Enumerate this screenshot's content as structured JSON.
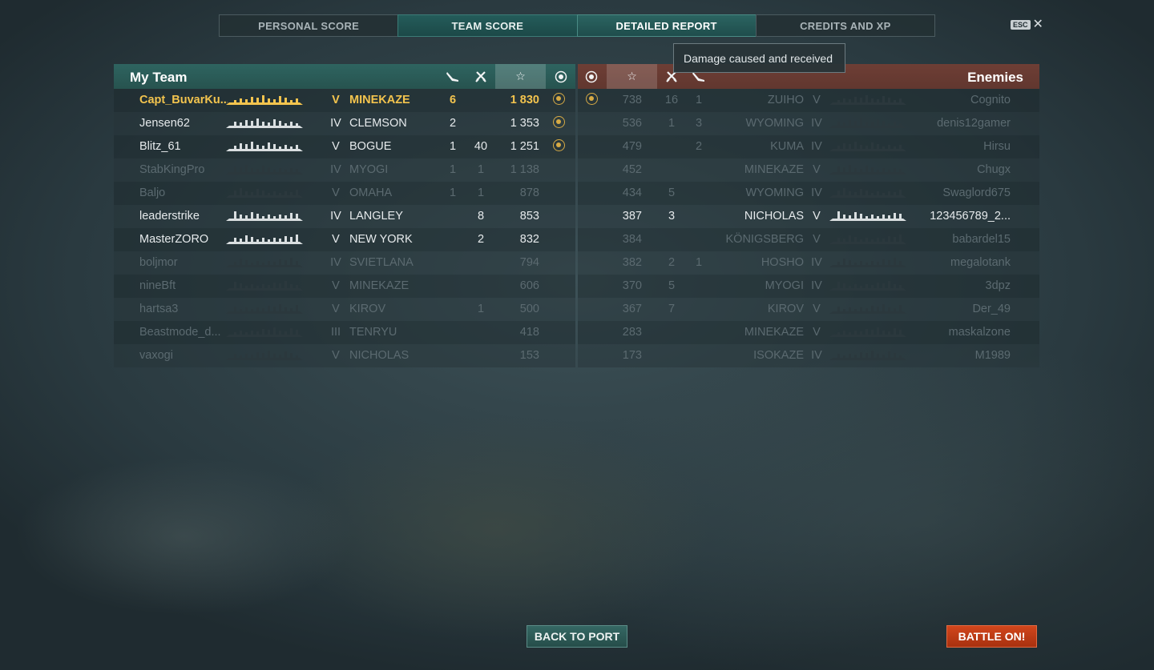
{
  "tabs": [
    {
      "label": "PERSONAL SCORE",
      "active": false
    },
    {
      "label": "TEAM SCORE",
      "active": true
    },
    {
      "label": "DETAILED REPORT",
      "active": true
    },
    {
      "label": "CREDITS AND XP",
      "active": false
    }
  ],
  "esc_label": "ESC",
  "close_glyph": "✕",
  "tooltip": "Damage caused and received",
  "my_team": {
    "title": "My Team",
    "header_icons": [
      "torpedo-icon",
      "planes-icon",
      "star-icon",
      "medal-icon"
    ],
    "rows": [
      {
        "player": "Capt_BuvarKu...",
        "tier": "V",
        "ship": "MINEKAZE",
        "c1": "6",
        "c2": "",
        "score": "1 830",
        "medal": true,
        "state": "self"
      },
      {
        "player": "Jensen62",
        "tier": "IV",
        "ship": "CLEMSON",
        "c1": "2",
        "c2": "",
        "score": "1 353",
        "medal": true,
        "state": "alive"
      },
      {
        "player": "Blitz_61",
        "tier": "V",
        "ship": "BOGUE",
        "c1": "1",
        "c2": "40",
        "score": "1 251",
        "medal": true,
        "state": "alive"
      },
      {
        "player": "StabKingPro",
        "tier": "IV",
        "ship": "MYOGI",
        "c1": "1",
        "c2": "1",
        "score": "1 138",
        "medal": false,
        "state": "dead"
      },
      {
        "player": "Baljo",
        "tier": "V",
        "ship": "OMAHA",
        "c1": "1",
        "c2": "1",
        "score": "878",
        "medal": false,
        "state": "dead"
      },
      {
        "player": "leaderstrike",
        "tier": "IV",
        "ship": "LANGLEY",
        "c1": "",
        "c2": "8",
        "score": "853",
        "medal": false,
        "state": "alive"
      },
      {
        "player": "MasterZORO",
        "tier": "V",
        "ship": "NEW YORK",
        "c1": "",
        "c2": "2",
        "score": "832",
        "medal": false,
        "state": "alive"
      },
      {
        "player": "boljmor",
        "tier": "IV",
        "ship": "SVIETLANA",
        "c1": "",
        "c2": "",
        "score": "794",
        "medal": false,
        "state": "dead"
      },
      {
        "player": "nineBft",
        "tier": "V",
        "ship": "MINEKAZE",
        "c1": "",
        "c2": "",
        "score": "606",
        "medal": false,
        "state": "dead"
      },
      {
        "player": "hartsa3",
        "tier": "V",
        "ship": "KIROV",
        "c1": "",
        "c2": "1",
        "score": "500",
        "medal": false,
        "state": "dead"
      },
      {
        "player": "Beastmode_d...",
        "tier": "III",
        "ship": "TENRYU",
        "c1": "",
        "c2": "",
        "score": "418",
        "medal": false,
        "state": "dead"
      },
      {
        "player": "vaxogi",
        "tier": "V",
        "ship": "NICHOLAS",
        "c1": "",
        "c2": "",
        "score": "153",
        "medal": false,
        "state": "dead"
      }
    ]
  },
  "enemies": {
    "title": "Enemies",
    "header_icons": [
      "medal-icon",
      "star-icon",
      "planes-icon",
      "torpedo-icon"
    ],
    "rows": [
      {
        "player": "Cognito",
        "tier": "V",
        "ship": "ZUIHO",
        "c1": "1",
        "c2": "16",
        "score": "738",
        "medal": true,
        "state": "dead"
      },
      {
        "player": "denis12gamer",
        "tier": "IV",
        "ship": "WYOMING",
        "c1": "3",
        "c2": "1",
        "score": "536",
        "medal": false,
        "state": "dead"
      },
      {
        "player": "Hirsu",
        "tier": "IV",
        "ship": "KUMA",
        "c1": "2",
        "c2": "",
        "score": "479",
        "medal": false,
        "state": "dead"
      },
      {
        "player": "Chugx",
        "tier": "V",
        "ship": "MINEKAZE",
        "c1": "",
        "c2": "",
        "score": "452",
        "medal": false,
        "state": "dead"
      },
      {
        "player": "Swaglord675",
        "tier": "IV",
        "ship": "WYOMING",
        "c1": "",
        "c2": "5",
        "score": "434",
        "medal": false,
        "state": "dead"
      },
      {
        "player": "123456789_2...",
        "tier": "V",
        "ship": "NICHOLAS",
        "c1": "",
        "c2": "3",
        "score": "387",
        "medal": false,
        "state": "alive"
      },
      {
        "player": "babardel15",
        "tier": "V",
        "ship": "KÖNIGSBERG",
        "c1": "",
        "c2": "",
        "score": "384",
        "medal": false,
        "state": "dead"
      },
      {
        "player": "megalotank",
        "tier": "IV",
        "ship": "HOSHO",
        "c1": "1",
        "c2": "2",
        "score": "382",
        "medal": false,
        "state": "dead"
      },
      {
        "player": "3dpz",
        "tier": "IV",
        "ship": "MYOGI",
        "c1": "",
        "c2": "5",
        "score": "370",
        "medal": false,
        "state": "dead"
      },
      {
        "player": "Der_49",
        "tier": "V",
        "ship": "KIROV",
        "c1": "",
        "c2": "7",
        "score": "367",
        "medal": false,
        "state": "dead"
      },
      {
        "player": "maskalzone",
        "tier": "V",
        "ship": "MINEKAZE",
        "c1": "",
        "c2": "",
        "score": "283",
        "medal": false,
        "state": "dead"
      },
      {
        "player": "M1989",
        "tier": "IV",
        "ship": "ISOKAZE",
        "c1": "",
        "c2": "",
        "score": "173",
        "medal": false,
        "state": "dead"
      }
    ]
  },
  "buttons": {
    "back": "BACK TO PORT",
    "battle": "BATTLE ON!"
  },
  "colors": {
    "self": "#f3c44e",
    "my_team_header": "#2e6460",
    "enemy_header": "#6e3e35",
    "battle_button": "#d2461c"
  }
}
